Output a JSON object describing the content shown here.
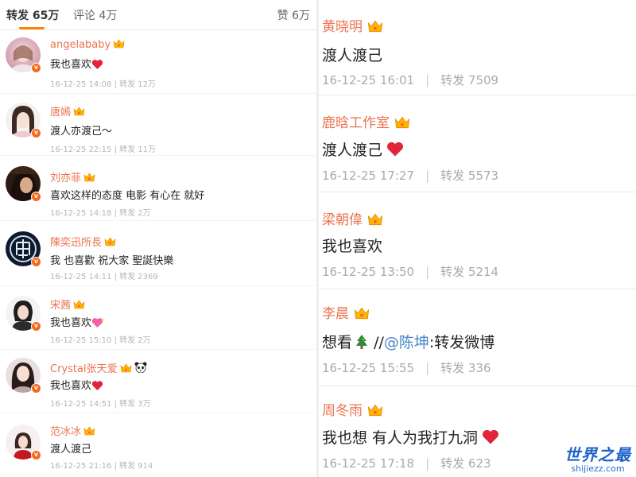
{
  "tabs": {
    "repost": "转发 65万",
    "comment": "评论 4万",
    "like": "赞 6万"
  },
  "colors": {
    "accent": "#ff8200",
    "name": "#eb7350",
    "badge": "#f26a1b",
    "link": "#4a87c6"
  },
  "left_items": [
    {
      "name": "angelababy",
      "text": "我也喜欢",
      "emoji": "red-heart",
      "date": "16-12-25 14:08",
      "reposts": "转发 12万",
      "avatar_icon": "avatar-angelababy"
    },
    {
      "name": "唐嫣",
      "text": "渡人亦渡己～",
      "emoji": "",
      "date": "16-12-25 22:15",
      "reposts": "转发 11万",
      "avatar_icon": "avatar-tangyan"
    },
    {
      "name": "刘亦菲",
      "text": "喜欢这样的态度 电影 有心在 就好",
      "emoji": "",
      "date": "16-12-25 14:18",
      "reposts": "转发 2万",
      "avatar_icon": "avatar-liuyifei"
    },
    {
      "name": "陳奕迅所長",
      "text": "我 也喜歡 祝大家 聖誕快樂",
      "emoji": "",
      "date": "16-12-25 14:11",
      "reposts": "转发 2369",
      "avatar_icon": "avatar-eason"
    },
    {
      "name": "宋茜",
      "text": "我也喜欢",
      "emoji": "sparkle-heart",
      "date": "16-12-25 15:10",
      "reposts": "转发 2万",
      "avatar_icon": "avatar-songqian"
    },
    {
      "name": "Crystal张天爱",
      "text": "我也喜欢",
      "emoji": "red-heart",
      "date": "16-12-25 14:51",
      "reposts": "转发 3万",
      "avatar_icon": "avatar-crystal"
    },
    {
      "name": "范冰冰",
      "text": "渡人渡己",
      "emoji": "",
      "date": "16-12-25 21:16",
      "reposts": "转发 914",
      "avatar_icon": "avatar-fanbingbing"
    }
  ],
  "right_items": [
    {
      "name": "黄晓明",
      "text": "渡人渡己",
      "emoji": "",
      "date": "16-12-25 16:01",
      "reposts": "转发 7509"
    },
    {
      "name": "鹿晗工作室",
      "text": "渡人渡己",
      "emoji": "red-heart",
      "date": "16-12-25 17:27",
      "reposts": "转发 5573"
    },
    {
      "name": "梁朝偉",
      "text": "我也喜欢",
      "emoji": "",
      "date": "16-12-25 13:50",
      "reposts": "转发 5214"
    },
    {
      "name": "李晨",
      "text": "想看",
      "emoji": "christmas-tree-icon",
      "mention_prefix": "//",
      "mention": "@陈坤",
      "mention_suffix": ":转发微博",
      "date": "16-12-25 15:55",
      "reposts": "转发 336"
    },
    {
      "name": "周冬雨",
      "text": "我也想 有人为我打九洞",
      "emoji": "red-heart",
      "date": "16-12-25 17:18",
      "reposts": "转发 623"
    }
  ],
  "watermark": {
    "title": "世界之最",
    "url": "shijiezz.com"
  }
}
